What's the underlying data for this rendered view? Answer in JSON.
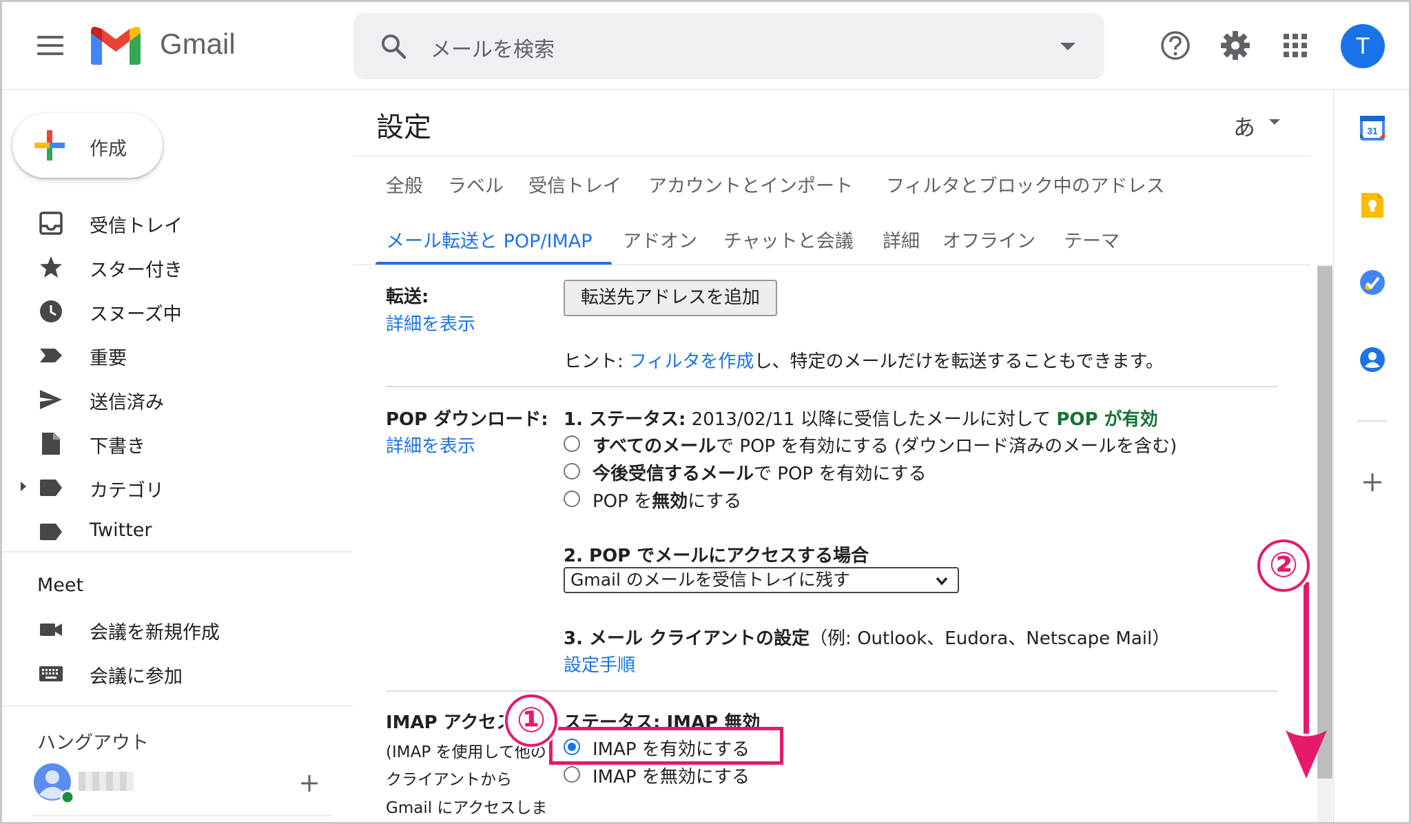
{
  "header": {
    "app_name": "Gmail",
    "search_placeholder": "メールを検索",
    "avatar_initial": "T"
  },
  "sidebar": {
    "compose_label": "作成",
    "items": [
      {
        "label": "受信トレイ",
        "icon": "inbox-icon"
      },
      {
        "label": "スター付き",
        "icon": "star-icon"
      },
      {
        "label": "スヌーズ中",
        "icon": "clock-icon"
      },
      {
        "label": "重要",
        "icon": "important-icon"
      },
      {
        "label": "送信済み",
        "icon": "send-icon"
      },
      {
        "label": "下書き",
        "icon": "draft-icon"
      },
      {
        "label": "カテゴリ",
        "icon": "label-icon"
      },
      {
        "label": "Twitter",
        "icon": "label-icon"
      }
    ],
    "meet": {
      "title": "Meet",
      "items": [
        {
          "label": "会議を新規作成",
          "icon": "video-camera-icon"
        },
        {
          "label": "会議に参加",
          "icon": "keyboard-icon"
        }
      ]
    },
    "hangouts": {
      "title": "ハングアウト"
    }
  },
  "settings": {
    "title": "設定",
    "lang_label": "あ",
    "tabs_row1": [
      "全般",
      "ラベル",
      "受信トレイ",
      "アカウントとインポート",
      "フィルタとブロック中のアドレス"
    ],
    "tabs_row2": [
      "メール転送と POP/IMAP",
      "アドオン",
      "チャットと会議",
      "詳細",
      "オフライン",
      "テーマ"
    ],
    "forwarding": {
      "label": "転送:",
      "details_link": "詳細を表示",
      "add_button": "転送先アドレスを追加",
      "hint_prefix": "ヒント: ",
      "hint_link": "フィルタを作成",
      "hint_suffix": "し、特定のメールだけを転送することもできます。"
    },
    "pop": {
      "label": "POP ダウンロード:",
      "details_link": "詳細を表示",
      "status_prefix": "1. ステータス:",
      "status_text": " 2013/02/11 以降に受信したメールに対して ",
      "status_value": "POP が有効",
      "opt1_bold": "すべてのメール",
      "opt1_rest": "で POP を有効にする (ダウンロード済みのメールを含む)",
      "opt2_bold": "今後受信するメール",
      "opt2_rest": "で POP を有効にする",
      "opt3_pre": "POP を",
      "opt3_bold": "無効",
      "opt3_post": "にする",
      "access_title": "2. POP でメールにアクセスする場合",
      "access_select": "Gmail のメールを受信トレイに残す",
      "client_title": "3. メール クライアントの設定",
      "client_note": "（例: Outlook、Eudora、Netscape Mail）",
      "client_link": "設定手順"
    },
    "imap": {
      "label": "IMAP アクセス:",
      "desc1": "(IMAP を使用して他の",
      "desc2": "クライアントから",
      "desc3": "Gmail にアクセスしま",
      "status": "ステータス: IMAP 無効",
      "opt_enable": "IMAP を有効にする",
      "opt_disable": "IMAP を無効にする"
    }
  },
  "annotations": {
    "step1": "①",
    "step2": "②",
    "highlight_color": "#e6196b"
  },
  "colors": {
    "accent": "#1a73e8",
    "pop_enabled": "#137333"
  }
}
